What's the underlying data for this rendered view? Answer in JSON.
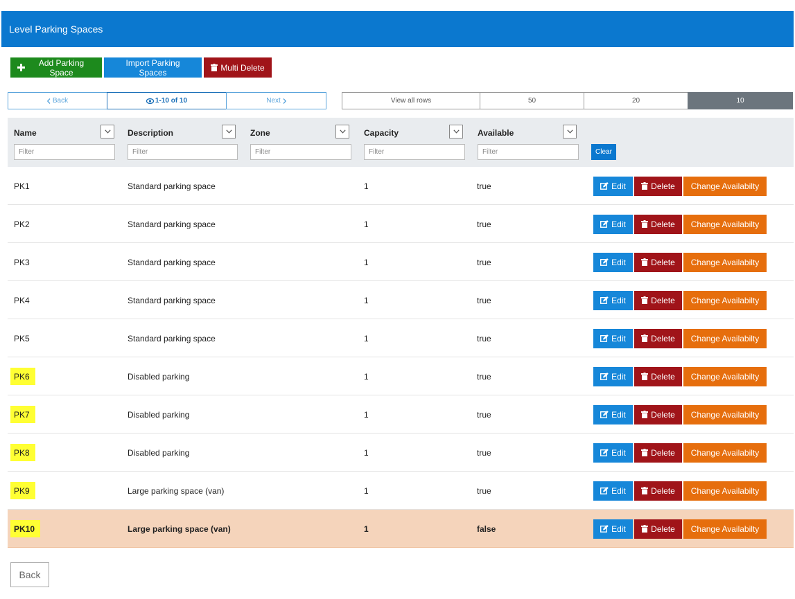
{
  "header": {
    "title": "Level Parking Spaces"
  },
  "toolbar": {
    "add_label": "Add Parking Space",
    "import_label": "Import Parking Spaces",
    "multi_delete_label": "Multi Delete"
  },
  "pager": {
    "back_label": "Back",
    "count_label": "1-10 of 10",
    "next_label": "Next"
  },
  "rows_per_page": {
    "options": [
      "View all rows",
      "50",
      "20",
      "10"
    ],
    "selected": "10"
  },
  "columns": [
    {
      "label": "Name",
      "placeholder": "Filter"
    },
    {
      "label": "Description",
      "placeholder": "Filter"
    },
    {
      "label": "Zone",
      "placeholder": "Filter"
    },
    {
      "label": "Capacity",
      "placeholder": "Filter"
    },
    {
      "label": "Available",
      "placeholder": "Filter"
    }
  ],
  "clear_label": "Clear",
  "actions": {
    "edit": "Edit",
    "delete": "Delete",
    "change": "Change Availabilty"
  },
  "rows": [
    {
      "name": "PK1",
      "description": "Standard parking space",
      "zone": "",
      "capacity": "1",
      "available": "true"
    },
    {
      "name": "PK2",
      "description": "Standard parking space",
      "zone": "",
      "capacity": "1",
      "available": "true"
    },
    {
      "name": "PK3",
      "description": "Standard parking space",
      "zone": "",
      "capacity": "1",
      "available": "true"
    },
    {
      "name": "PK4",
      "description": "Standard parking space",
      "zone": "",
      "capacity": "1",
      "available": "true"
    },
    {
      "name": "PK5",
      "description": "Standard parking space",
      "zone": "",
      "capacity": "1",
      "available": "true"
    },
    {
      "name": "PK6",
      "description": "Disabled parking",
      "zone": "",
      "capacity": "1",
      "available": "true"
    },
    {
      "name": "PK7",
      "description": "Disabled parking",
      "zone": "",
      "capacity": "1",
      "available": "true"
    },
    {
      "name": "PK8",
      "description": "Disabled parking",
      "zone": "",
      "capacity": "1",
      "available": "true"
    },
    {
      "name": "PK9",
      "description": "Large parking space (van)",
      "zone": "",
      "capacity": "1",
      "available": "true"
    },
    {
      "name": "PK10",
      "description": "Large parking space (van)",
      "zone": "",
      "capacity": "1",
      "available": "false"
    }
  ],
  "highlighted_rows": [
    "PK6",
    "PK7",
    "PK8",
    "PK9",
    "PK10"
  ],
  "selected_row": "PK10",
  "footer": {
    "back_label": "Back"
  },
  "colors": {
    "header_bg": "#0b78cf",
    "add_green": "#1d8a1d",
    "primary_blue": "#1687d9",
    "danger_red": "#a01419",
    "warning_orange": "#e66e0d",
    "selected_row_bg": "#f5d4bb",
    "highlight_yellow": "#ffff33"
  },
  "icons": {
    "add": "plus-icon",
    "delete": "trash-icon",
    "edit": "edit-icon",
    "count": "eye-icon",
    "back": "chevron-left-icon",
    "next": "chevron-right-icon",
    "dropdown": "chevron-down-icon"
  }
}
